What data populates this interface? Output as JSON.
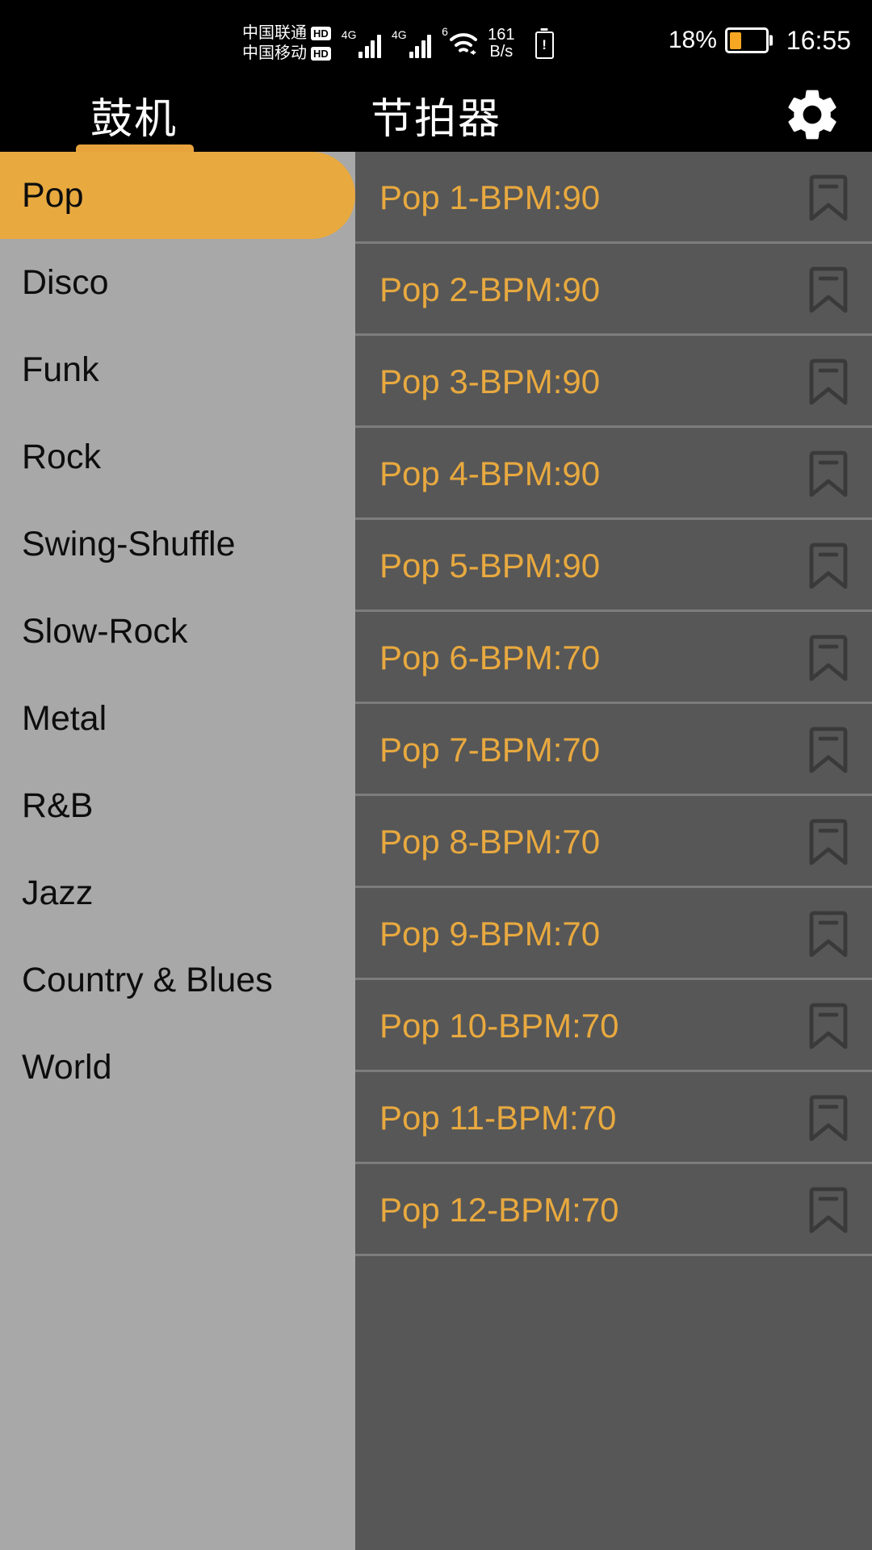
{
  "statusbar": {
    "carrier1": "中国联通",
    "carrier1_badge": "HD",
    "carrier2": "中国移动",
    "carrier2_badge": "HD",
    "net1": "4G",
    "net2": "4G",
    "wifi_label": "6",
    "speed_value": "161",
    "speed_unit": "B/s",
    "battery_percent": "18%",
    "clock": "16:55",
    "icons": {
      "signal1": "signal-bars-icon",
      "signal2": "signal-bars-icon",
      "wifi": "wifi-icon",
      "battery_alert": "battery-alert-icon",
      "battery": "battery-icon"
    }
  },
  "header": {
    "tabs": [
      {
        "label": "鼓机",
        "active": true
      },
      {
        "label": "节拍器",
        "active": false
      }
    ],
    "settings_icon": "gear-icon"
  },
  "colors": {
    "accent": "#e8a93f",
    "tab_indicator": "#e8a33d",
    "sidebar_bg": "#a8a8a8",
    "list_bg": "#575757",
    "divider": "#7d7d7d",
    "statusbar_bg": "#000000",
    "battery_fill": "#f5a623"
  },
  "sidebar": {
    "items": [
      {
        "label": "Pop",
        "selected": true
      },
      {
        "label": "Disco",
        "selected": false
      },
      {
        "label": "Funk",
        "selected": false
      },
      {
        "label": "Rock",
        "selected": false
      },
      {
        "label": "Swing-Shuffle",
        "selected": false
      },
      {
        "label": "Slow-Rock",
        "selected": false
      },
      {
        "label": "Metal",
        "selected": false
      },
      {
        "label": "R&B",
        "selected": false
      },
      {
        "label": "Jazz",
        "selected": false
      },
      {
        "label": "Country & Blues",
        "selected": false
      },
      {
        "label": "World",
        "selected": false
      }
    ]
  },
  "list": {
    "bookmark_icon": "bookmark-icon",
    "items": [
      {
        "label": "Pop 1-BPM:90"
      },
      {
        "label": "Pop 2-BPM:90"
      },
      {
        "label": "Pop 3-BPM:90"
      },
      {
        "label": "Pop 4-BPM:90"
      },
      {
        "label": "Pop 5-BPM:90"
      },
      {
        "label": "Pop 6-BPM:70"
      },
      {
        "label": "Pop 7-BPM:70"
      },
      {
        "label": "Pop 8-BPM:70"
      },
      {
        "label": "Pop 9-BPM:70"
      },
      {
        "label": "Pop 10-BPM:70"
      },
      {
        "label": "Pop 11-BPM:70"
      },
      {
        "label": "Pop 12-BPM:70"
      }
    ]
  }
}
